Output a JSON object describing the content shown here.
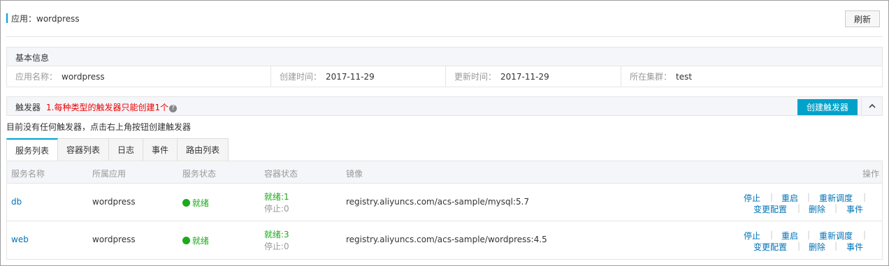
{
  "header": {
    "title": "应用：wordpress",
    "refresh_label": "刷新"
  },
  "basic_info": {
    "section_title": "基本信息",
    "fields": [
      {
        "label": "应用名称：",
        "value": "wordpress"
      },
      {
        "label": "创建时间：",
        "value": "2017-11-29"
      },
      {
        "label": "更新时间：",
        "value": "2017-11-29"
      },
      {
        "label": "所在集群：",
        "value": "test"
      }
    ]
  },
  "triggers": {
    "section_title": "触发器",
    "warning": "1.每种类型的触发器只能创建1个",
    "help_icon": "question-icon",
    "create_label": "创建触发器",
    "collapse_icon": "chevron-up-icon",
    "empty_note": "目前没有任何触发器，点击右上角按钮创建触发器"
  },
  "tabs": [
    {
      "label": "服务列表",
      "active": true
    },
    {
      "label": "容器列表",
      "active": false
    },
    {
      "label": "日志",
      "active": false
    },
    {
      "label": "事件",
      "active": false
    },
    {
      "label": "路由列表",
      "active": false
    }
  ],
  "table": {
    "columns": [
      "服务名称",
      "所属应用",
      "服务状态",
      "容器状态",
      "镜像",
      "操作"
    ],
    "rows": [
      {
        "name": "db",
        "app": "wordpress",
        "status": "就绪",
        "container_ready": "就绪:1",
        "container_stopped": "停止:0",
        "image": "registry.aliyuncs.com/acs-sample/mysql:5.7"
      },
      {
        "name": "web",
        "app": "wordpress",
        "status": "就绪",
        "container_ready": "就绪:3",
        "container_stopped": "停止:0",
        "image": "registry.aliyuncs.com/acs-sample/wordpress:4.5"
      }
    ],
    "actions": {
      "stop": "停止",
      "restart": "重启",
      "reschedule": "重新调度",
      "change_config": "变更配置",
      "delete": "删除",
      "events": "事件"
    }
  },
  "colors": {
    "accent": "#00a2ca",
    "link": "#0073b8",
    "ready": "#1aab1a",
    "warning": "#e00000"
  }
}
